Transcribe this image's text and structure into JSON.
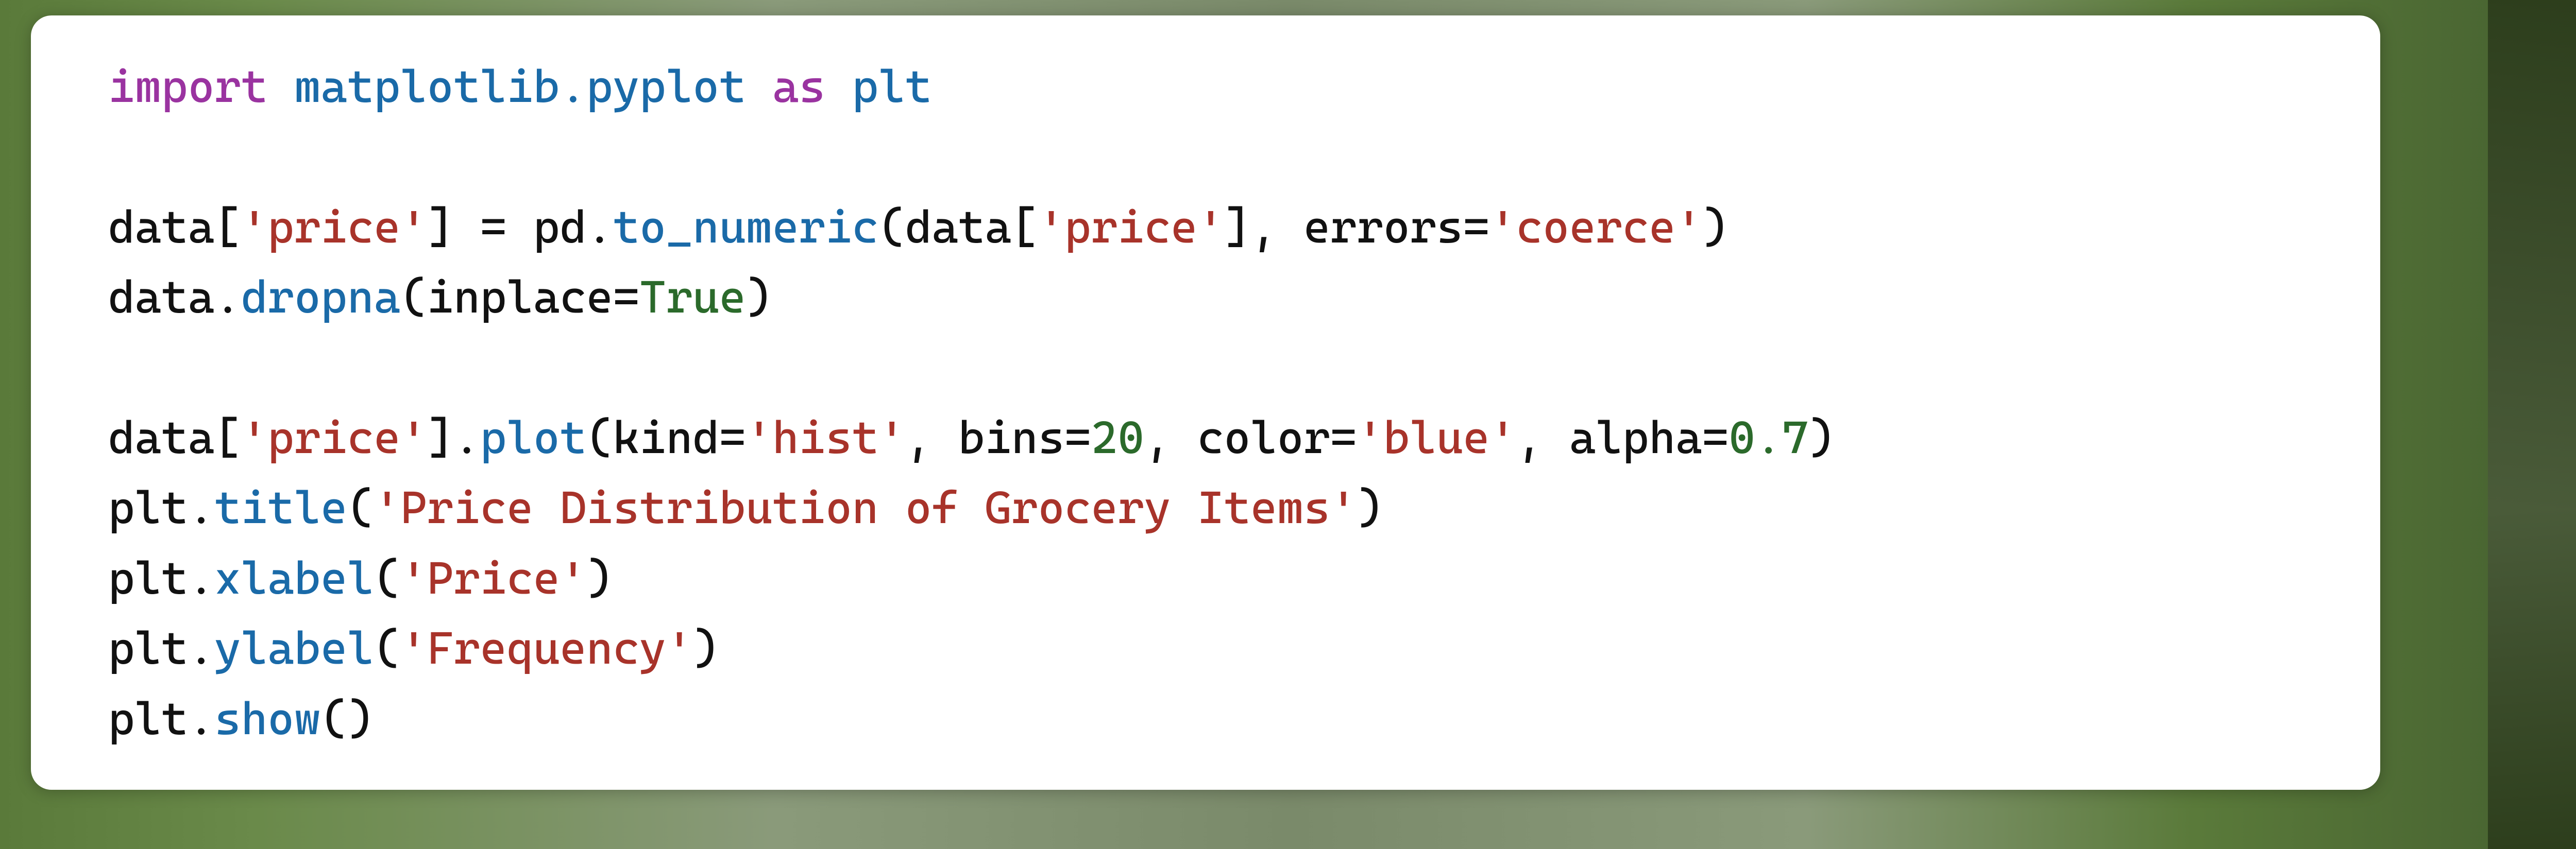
{
  "code": {
    "line1": {
      "kw_import": "import",
      "module": "matplotlib.pyplot",
      "kw_as": "as",
      "alias": "plt"
    },
    "line3": {
      "lhs_obj": "data",
      "lhs_key": "'price'",
      "eq": " = ",
      "rhs_mod": "pd",
      "rhs_func": "to_numeric",
      "arg_obj": "data",
      "arg_key": "'price'",
      "kw_errors": "errors",
      "val_errors": "'coerce'"
    },
    "line4": {
      "obj": "data",
      "method": "dropna",
      "kw_inplace": "inplace",
      "val_inplace": "True"
    },
    "line6": {
      "obj": "data",
      "key": "'price'",
      "method": "plot",
      "kw_kind": "kind",
      "val_kind": "'hist'",
      "kw_bins": "bins",
      "val_bins": "20",
      "kw_color": "color",
      "val_color": "'blue'",
      "kw_alpha": "alpha",
      "val_alpha": "0.7"
    },
    "line7": {
      "obj": "plt",
      "method": "title",
      "arg": "'Price Distribution of Grocery Items'"
    },
    "line8": {
      "obj": "plt",
      "method": "xlabel",
      "arg": "'Price'"
    },
    "line9": {
      "obj": "plt",
      "method": "ylabel",
      "arg": "'Frequency'"
    },
    "line10": {
      "obj": "plt",
      "method": "show"
    }
  }
}
